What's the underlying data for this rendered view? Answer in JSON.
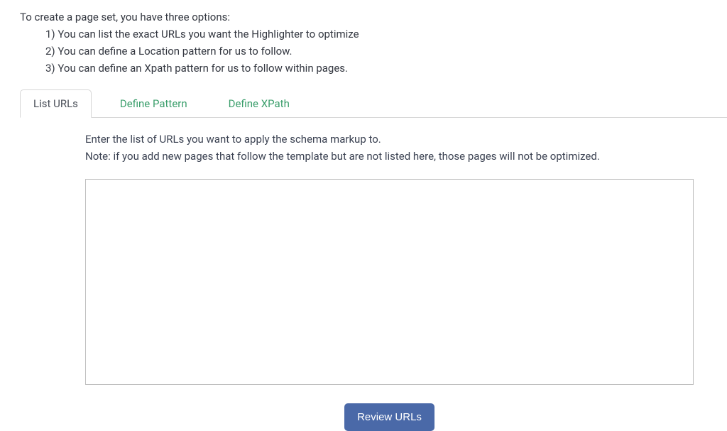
{
  "intro": {
    "heading": "To create a page set, you have three options:",
    "items": [
      "1) You can list the exact URLs you want the Highlighter to optimize",
      "2) You can define a Location pattern for us to follow.",
      "3) You can define an Xpath pattern for us to follow within pages."
    ]
  },
  "tabs": {
    "listUrls": "List URLs",
    "definePattern": "Define Pattern",
    "defineXpath": "Define XPath"
  },
  "content": {
    "helperLine1": "Enter the list of URLs you want to apply the schema markup to.",
    "helperLine2": "Note: if you add new pages that follow the template but are not listed here, those pages will not be optimized.",
    "textareaValue": ""
  },
  "buttons": {
    "reviewUrls": "Review URLs"
  }
}
